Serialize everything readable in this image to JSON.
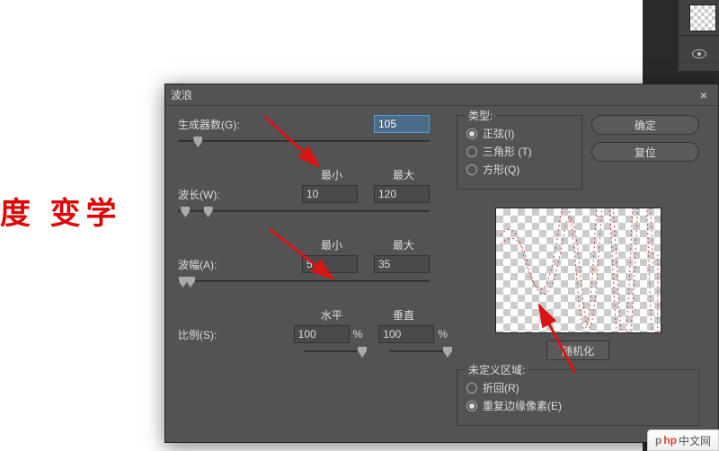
{
  "canvas": {
    "text": "度  变学"
  },
  "dialog": {
    "title": "波浪",
    "close": "×",
    "generators": {
      "label": "生成器数(G):",
      "value": "105"
    },
    "wavelength": {
      "label": "波长(W):",
      "min_label": "最小",
      "max_label": "最大",
      "min": "10",
      "max": "120"
    },
    "amplitude": {
      "label": "波幅(A):",
      "min_label": "最小",
      "max_label": "最大",
      "min": "5",
      "max": "35"
    },
    "scale": {
      "label": "比例(S):",
      "h_label": "水平",
      "v_label": "垂直",
      "h": "100",
      "v": "100",
      "pct": "%"
    },
    "type": {
      "legend": "类型:",
      "options": [
        {
          "label": "正弦(I)",
          "checked": true
        },
        {
          "label": "三角形 (T)",
          "checked": false
        },
        {
          "label": "方形(Q)",
          "checked": false
        }
      ]
    },
    "buttons": {
      "ok": "确定",
      "reset": "复位",
      "randomize": "随机化"
    },
    "undefined_area": {
      "legend": "未定义区域:",
      "options": [
        {
          "label": "折回(R)",
          "checked": false
        },
        {
          "label": "重复边缘像素(E)",
          "checked": true
        }
      ]
    }
  },
  "watermark": {
    "p": "p",
    "h": "hp",
    "cn": "中文网"
  }
}
